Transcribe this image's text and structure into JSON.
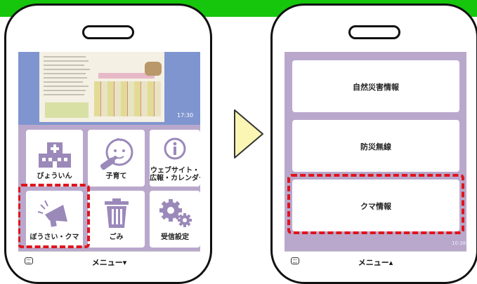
{
  "colors": {
    "top_bar": "#16c60c",
    "screen_bg": "#b9a8cc",
    "banner": "#7f95cf",
    "highlight": "#e0141c",
    "arrow_fill": "#fbf6b4",
    "icon_color": "#9b89ba"
  },
  "left_phone": {
    "banner_time": "17:30",
    "tiles": [
      {
        "label": "びょういん",
        "icon": "hospital-icon"
      },
      {
        "label": "子育て",
        "icon": "baby-icon"
      },
      {
        "label_line1": "ウェブサイト・",
        "label_line2": "広報・カレンダー",
        "icon": "info-icon"
      },
      {
        "label": "ぼうさい・クマ",
        "icon": "megaphone-icon"
      },
      {
        "label": "ごみ",
        "icon": "trash-icon"
      },
      {
        "label": "受信設定",
        "icon": "gear-icon"
      }
    ],
    "menu_label": "メニュー▾"
  },
  "right_phone": {
    "cards": [
      {
        "label": "自然災害情報"
      },
      {
        "label": "防災無線"
      },
      {
        "label": "クマ情報"
      }
    ],
    "screen_time": "10:38",
    "menu_label": "メニュー▴"
  }
}
